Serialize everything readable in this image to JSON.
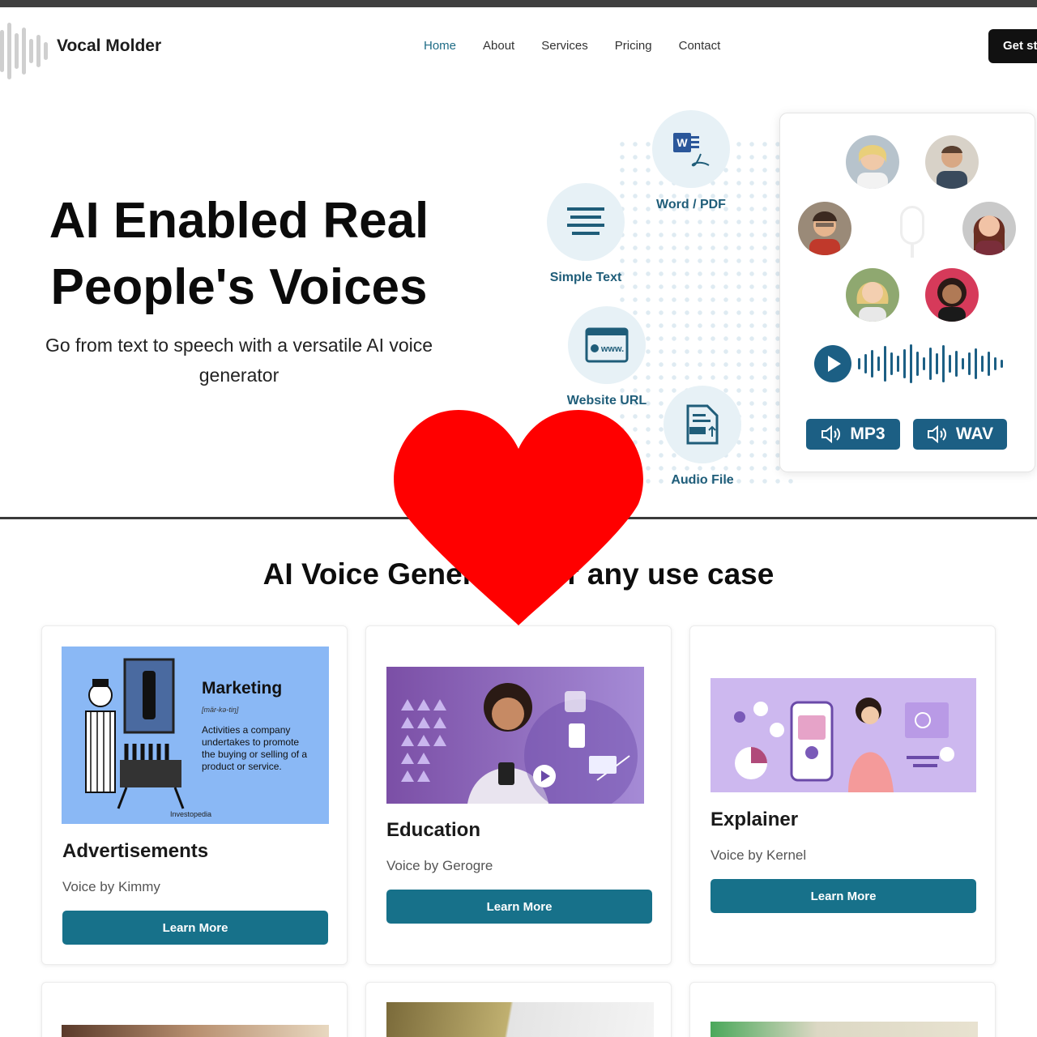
{
  "header": {
    "brand": "Vocal Molder",
    "nav": [
      {
        "label": "Home",
        "active": true
      },
      {
        "label": "About",
        "active": false
      },
      {
        "label": "Services",
        "active": false
      },
      {
        "label": "Pricing",
        "active": false
      },
      {
        "label": "Contact",
        "active": false
      }
    ],
    "cta_label": "Get st"
  },
  "hero": {
    "title_line1": "AI Enabled Real",
    "title_line2": "People's Voices",
    "subtitle_line1": "Go from text to speech with a versatile AI voice",
    "subtitle_line2": "generator"
  },
  "sources": {
    "word_pdf": "Word / PDF",
    "simple_text": "Simple Text",
    "website_url": "Website URL",
    "website_badge": "www.",
    "audio_file": "Audio File"
  },
  "formats": {
    "mp3": "MP3",
    "wav": "WAV"
  },
  "section": {
    "title": "AI Voice Generator for any use case"
  },
  "cards": [
    {
      "title": "Advertisements",
      "voice": "Voice by Kimmy",
      "button": "Learn More",
      "image": {
        "heading": "Marketing",
        "phonetic": "[mär-kə-tiŋ]",
        "body": "Activities a company undertakes to promote the buying or selling of a product or service.",
        "credit": "Investopedia"
      }
    },
    {
      "title": "Education",
      "voice": "Voice by Gerogre",
      "button": "Learn More"
    },
    {
      "title": "Explainer",
      "voice": "Voice by Kernel",
      "button": "Learn More"
    }
  ],
  "colors": {
    "accent": "#17718a",
    "nav_active": "#1f6c86",
    "panel_blue": "#1c5f84",
    "heart": "#ff0000"
  }
}
